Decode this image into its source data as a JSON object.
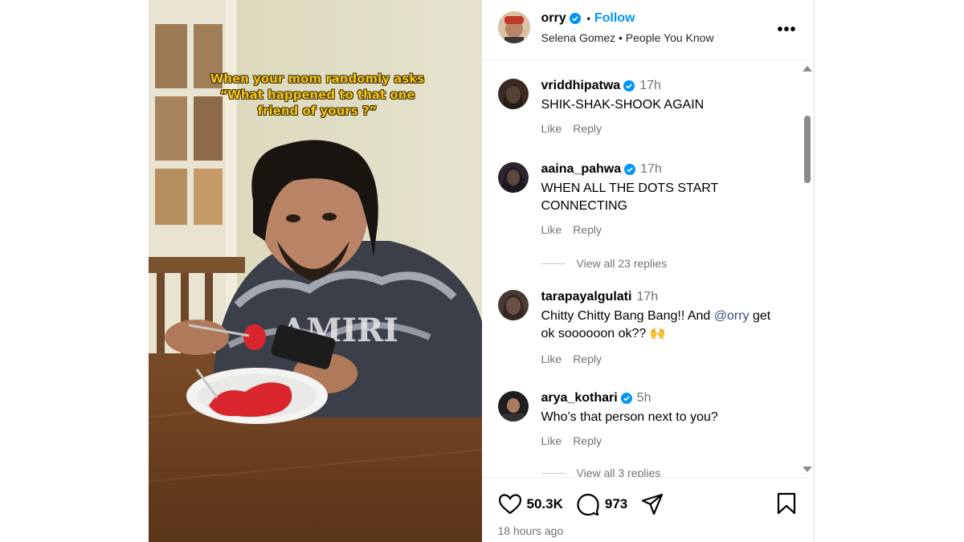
{
  "video": {
    "overlay_lines": [
      "When your mom randomly asks",
      "“What happened to that one",
      "friend of yours ?”"
    ],
    "shirt_text": "AMIRI"
  },
  "header": {
    "username": "orry",
    "verified": true,
    "separator": "•",
    "follow_label": "Follow",
    "subtitle": "Selena Gomez • People You Know",
    "more_label": "•••"
  },
  "comments": [
    {
      "username": "vriddhipatwa",
      "verified": true,
      "time": "17h",
      "text": "SHIK-SHAK-SHOOK AGAIN",
      "like": "Like",
      "reply": "Reply"
    },
    {
      "username": "aaina_pahwa",
      "verified": true,
      "time": "17h",
      "text": "WHEN ALL THE DOTS START CONNECTING",
      "like": "Like",
      "reply": "Reply",
      "view_replies": "View all 23 replies"
    },
    {
      "username": "tarapayalgulati",
      "verified": false,
      "time": "17h",
      "text_before": "Chitty Chitty Bang Bang!! And ",
      "mention": "@orry",
      "text_after": " get ok soooooon ok?? 🙌",
      "like": "Like",
      "reply": "Reply"
    },
    {
      "username": "arya_kothari",
      "verified": true,
      "time": "5h",
      "text": "Who’s that person next to you?",
      "like": "Like",
      "reply": "Reply",
      "view_replies": "View all 3 replies"
    }
  ],
  "footer": {
    "likes": "50.3K",
    "comments_count": "973",
    "posted": "18 hours ago"
  },
  "colors": {
    "accent": "#0095f6",
    "verified": "#0095f6",
    "muted": "#737373",
    "overlay_text": "#f5c518"
  },
  "icons": [
    "heart-icon",
    "comment-icon",
    "share-icon",
    "bookmark-icon",
    "verified-icon",
    "more-icon"
  ]
}
